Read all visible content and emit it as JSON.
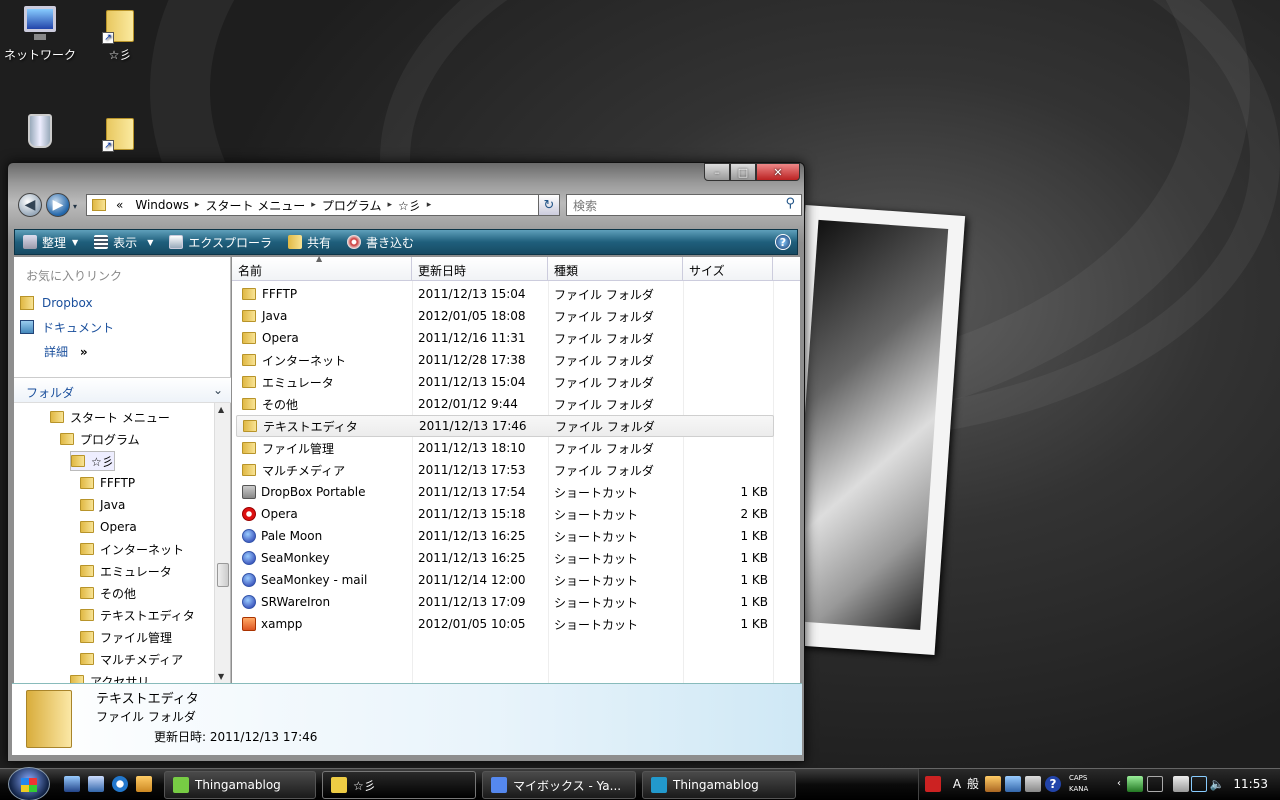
{
  "desktop": {
    "icons": [
      {
        "label": "ネットワーク"
      },
      {
        "label": "☆彡"
      },
      {
        "label": "ごみ箱"
      },
      {
        "label": ""
      }
    ]
  },
  "window": {
    "controls": {
      "minimize": "–",
      "maximize": "□",
      "close": "✕"
    },
    "breadcrumb": {
      "prefix": "«",
      "segments": [
        "Windows",
        "スタート メニュー",
        "プログラム",
        "☆彡"
      ],
      "separator": "▸"
    },
    "search_placeholder": "検索",
    "toolbar": [
      {
        "label": "整理",
        "icon": "organize-icon",
        "dropdown": true
      },
      {
        "label": "表示",
        "icon": "views-icon",
        "dropdown": true
      },
      {
        "label": "エクスプローラ",
        "icon": "explorer-icon"
      },
      {
        "label": "共有",
        "icon": "share-icon"
      },
      {
        "label": "書き込む",
        "icon": "burn-icon"
      }
    ],
    "left_pane": {
      "favorites_heading": "お気に入りリンク",
      "favorites": [
        {
          "label": "Dropbox"
        },
        {
          "label": "ドキュメント"
        }
      ],
      "more_label": "詳細",
      "more_glyph": "»",
      "folders_heading": "フォルダ",
      "tree": [
        {
          "label": "スタート メニュー",
          "indent": 1
        },
        {
          "label": "プログラム",
          "indent": 2
        },
        {
          "label": "☆彡",
          "indent": 3,
          "selected": true
        },
        {
          "label": "FFFTP",
          "indent": 4
        },
        {
          "label": "Java",
          "indent": 4
        },
        {
          "label": "Opera",
          "indent": 4
        },
        {
          "label": "インターネット",
          "indent": 4
        },
        {
          "label": "エミュレータ",
          "indent": 4
        },
        {
          "label": "その他",
          "indent": 4
        },
        {
          "label": "テキストエディタ",
          "indent": 4
        },
        {
          "label": "ファイル管理",
          "indent": 4
        },
        {
          "label": "マルチメディア",
          "indent": 4
        },
        {
          "label": "アクセサリ",
          "indent": 3
        }
      ]
    },
    "columns": [
      "名前",
      "更新日時",
      "種類",
      "サイズ"
    ],
    "files": [
      {
        "name": "FFFTP",
        "date": "2011/12/13 15:04",
        "type": "ファイル フォルダ",
        "size": "",
        "icon": "folder"
      },
      {
        "name": "Java",
        "date": "2012/01/05 18:08",
        "type": "ファイル フォルダ",
        "size": "",
        "icon": "folder"
      },
      {
        "name": "Opera",
        "date": "2011/12/16 11:31",
        "type": "ファイル フォルダ",
        "size": "",
        "icon": "folder"
      },
      {
        "name": "インターネット",
        "date": "2011/12/28 17:38",
        "type": "ファイル フォルダ",
        "size": "",
        "icon": "folder"
      },
      {
        "name": "エミュレータ",
        "date": "2011/12/13 15:04",
        "type": "ファイル フォルダ",
        "size": "",
        "icon": "folder"
      },
      {
        "name": "その他",
        "date": "2012/01/12 9:44",
        "type": "ファイル フォルダ",
        "size": "",
        "icon": "folder"
      },
      {
        "name": "テキストエディタ",
        "date": "2011/12/13 17:46",
        "type": "ファイル フォルダ",
        "size": "",
        "icon": "folder",
        "selected": true
      },
      {
        "name": "ファイル管理",
        "date": "2011/12/13 18:10",
        "type": "ファイル フォルダ",
        "size": "",
        "icon": "folder"
      },
      {
        "name": "マルチメディア",
        "date": "2011/12/13 17:53",
        "type": "ファイル フォルダ",
        "size": "",
        "icon": "folder"
      },
      {
        "name": "DropBox Portable",
        "date": "2011/12/13 17:54",
        "type": "ショートカット",
        "size": "1 KB",
        "icon": "drop"
      },
      {
        "name": "Opera",
        "date": "2011/12/13 15:18",
        "type": "ショートカット",
        "size": "2 KB",
        "icon": "opera"
      },
      {
        "name": "Pale Moon",
        "date": "2011/12/13 16:25",
        "type": "ショートカット",
        "size": "1 KB",
        "icon": "blue"
      },
      {
        "name": "SeaMonkey",
        "date": "2011/12/13 16:25",
        "type": "ショートカット",
        "size": "1 KB",
        "icon": "blue"
      },
      {
        "name": "SeaMonkey - mail",
        "date": "2011/12/14 12:00",
        "type": "ショートカット",
        "size": "1 KB",
        "icon": "blue"
      },
      {
        "name": "SRWareIron",
        "date": "2011/12/13 17:09",
        "type": "ショートカット",
        "size": "1 KB",
        "icon": "blue"
      },
      {
        "name": "xampp",
        "date": "2012/01/05 10:05",
        "type": "ショートカット",
        "size": "1 KB",
        "icon": "xampp"
      }
    ],
    "details_pane": {
      "name": "テキストエディタ",
      "type": "ファイル フォルダ",
      "modified_label": "更新日時:",
      "modified_value": "2011/12/13 17:46"
    }
  },
  "taskbar": {
    "tasks": [
      {
        "label": "Thingamablog",
        "icon": "thingamablog-icon"
      },
      {
        "label": "☆彡",
        "icon": "folder-icon",
        "active": true
      },
      {
        "label": "マイボックス - Ya...",
        "icon": "browser-icon"
      },
      {
        "label": "Thingamablog",
        "icon": "thingamablog-icon"
      }
    ],
    "tray": {
      "ime_mode": "A",
      "ime_kanji": "般",
      "caps": "CAPS",
      "kana": "KANA",
      "clock": "11:53"
    }
  }
}
